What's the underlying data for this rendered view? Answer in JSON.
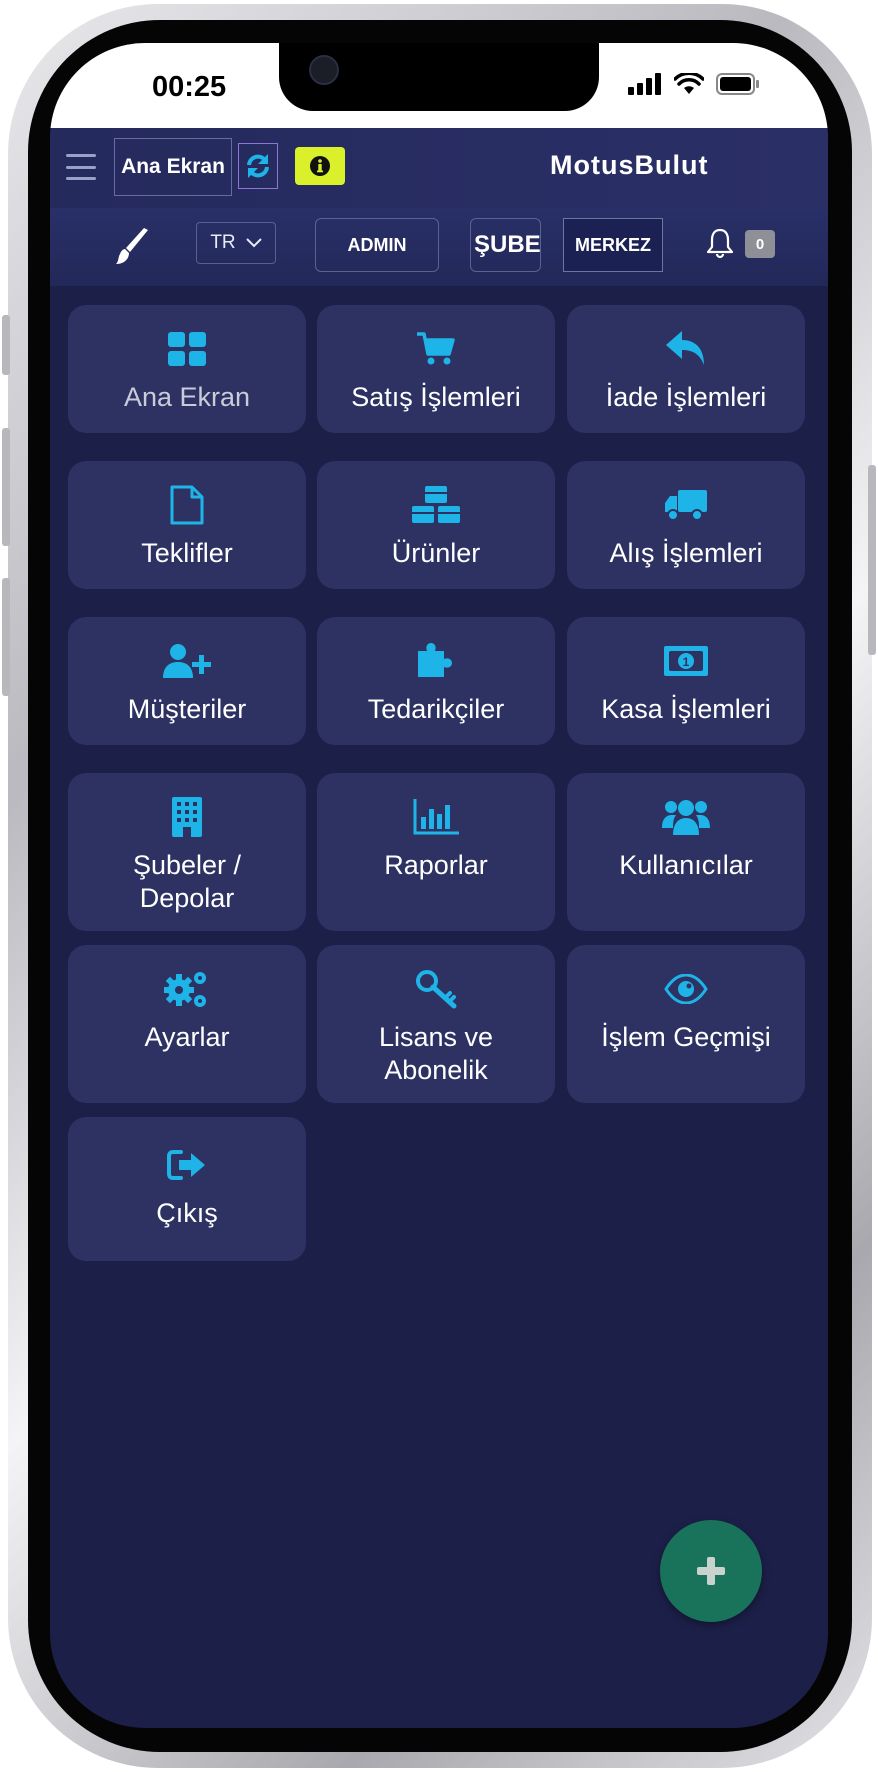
{
  "status_bar": {
    "time": "00:25"
  },
  "header": {
    "home_label": "Ana Ekran",
    "logo": "MotusBulut",
    "icons": {
      "menu": "hamburger-icon",
      "refresh": "sync-icon",
      "info": "info-circle-icon"
    }
  },
  "subheader": {
    "language": "TR",
    "admin_label": "ADMIN",
    "branch_label": "ŞUBE",
    "location_label": "MERKEZ",
    "notification_count": "0",
    "icons": {
      "theme": "paint-brush-icon",
      "notifications": "bell-icon"
    }
  },
  "menu": {
    "tiles": [
      {
        "label": "Ana Ekran",
        "icon": "grid-icon"
      },
      {
        "label": "Satış İşlemleri",
        "icon": "cart-icon"
      },
      {
        "label": "İade İşlemleri",
        "icon": "reply-arrow-icon"
      },
      {
        "label": "Teklifler",
        "icon": "document-icon"
      },
      {
        "label": "Ürünler",
        "icon": "cubes-icon"
      },
      {
        "label": "Alış İşlemleri",
        "icon": "truck-icon"
      },
      {
        "label": "Müşteriler",
        "icon": "user-plus-icon"
      },
      {
        "label": "Tedarikçiler",
        "icon": "puzzle-icon"
      },
      {
        "label": "Kasa İşlemleri",
        "icon": "money-bill-icon"
      },
      {
        "label": "Şubeler / Depolar",
        "label_line1": "Şubeler /",
        "label_line2": "Depolar",
        "icon": "building-icon"
      },
      {
        "label": "Raporlar",
        "icon": "bar-chart-icon"
      },
      {
        "label": "Kullanıcılar",
        "icon": "users-icon"
      },
      {
        "label": "Ayarlar",
        "icon": "gears-icon"
      },
      {
        "label": "Lisans ve Abonelik",
        "label_line1": "Lisans ve",
        "label_line2": "Abonelik",
        "icon": "key-icon"
      },
      {
        "label": "İşlem Geçmişi",
        "icon": "eye-icon"
      },
      {
        "label": "Çıkış",
        "icon": "sign-out-icon"
      }
    ]
  },
  "fab": {
    "icon": "plus-icon"
  },
  "colors": {
    "background": "#1c1f48",
    "tile": "#2d3263",
    "icon_accent": "#1eb4e8",
    "info_button": "#d9f02a",
    "fab": "#19725a"
  }
}
